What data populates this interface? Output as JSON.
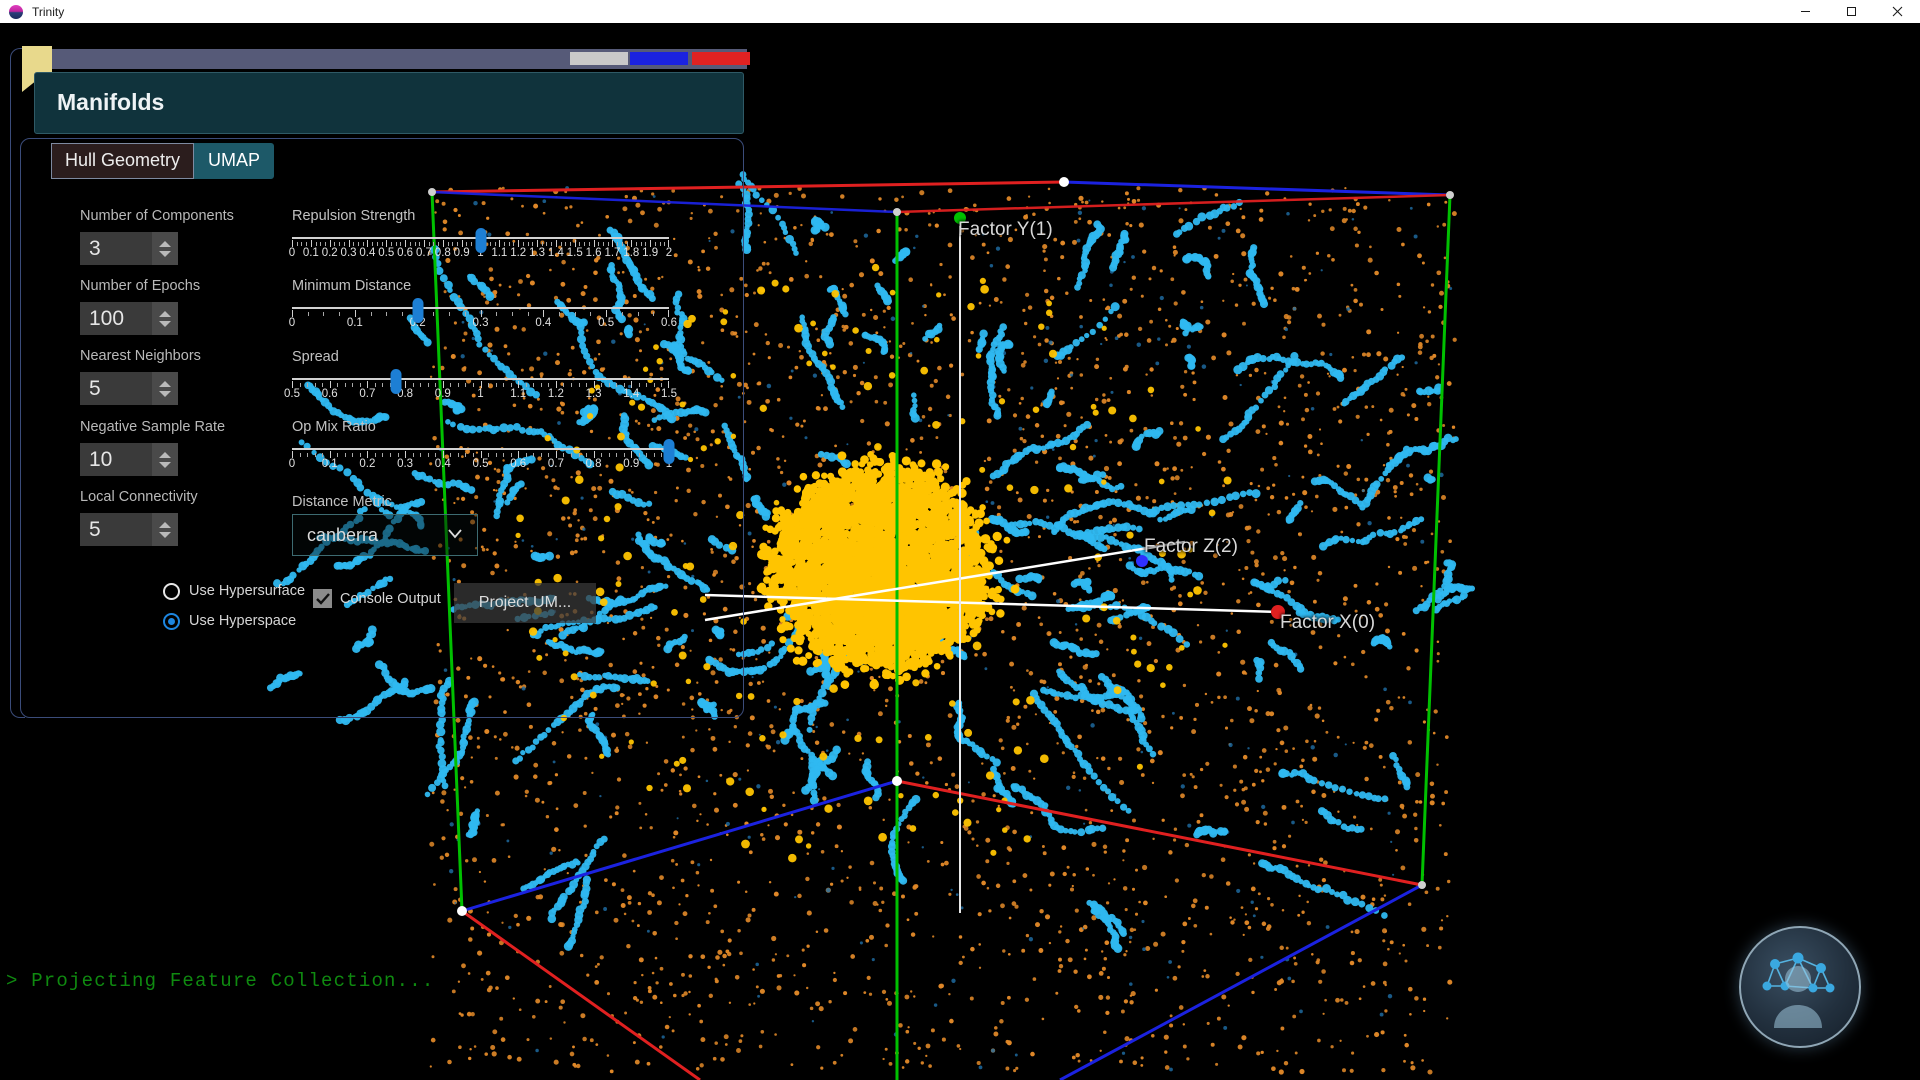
{
  "window": {
    "title": "Trinity",
    "app_icon": "trinity-orb-icon",
    "controls": [
      {
        "name": "minimize",
        "glyph": "minimize-icon"
      },
      {
        "name": "maximize",
        "glyph": "maximize-icon"
      },
      {
        "name": "close",
        "glyph": "close-icon"
      }
    ]
  },
  "panel": {
    "title": "Manifolds",
    "topbar_chips": [
      {
        "name": "chip-grey",
        "color": "#c9c9c9"
      },
      {
        "name": "chip-blue",
        "color": "#1b22e0"
      },
      {
        "name": "chip-red",
        "color": "#e02222"
      }
    ],
    "tabs": [
      {
        "label": "Hull Geometry",
        "active": false
      },
      {
        "label": "UMAP",
        "active": true
      }
    ],
    "numeric_fields": [
      {
        "label": "Number of Components",
        "value": "3"
      },
      {
        "label": "Number of Epochs",
        "value": "100"
      },
      {
        "label": "Nearest Neighbors",
        "value": "5"
      },
      {
        "label": "Negative Sample Rate",
        "value": "10"
      },
      {
        "label": "Local Connectivity",
        "value": "5"
      }
    ],
    "sliders": [
      {
        "label": "Repulsion Strength",
        "min": 0,
        "max": 2,
        "value": 1.0,
        "ticks": [
          "0",
          "0.1",
          "0.2",
          "0.3",
          "0.4",
          "0.5",
          "0.6",
          "0.7",
          "0.8",
          "0.9",
          "1",
          "1.1",
          "1.2",
          "1.3",
          "1.4",
          "1.5",
          "1.6",
          "1.7",
          "1.8",
          "1.9",
          "2"
        ],
        "minor_per_major": 4
      },
      {
        "label": "Minimum Distance",
        "min": 0,
        "max": 0.6,
        "value": 0.2,
        "ticks": [
          "0",
          "0.1",
          "0.2",
          "0.3",
          "0.4",
          "0.5",
          "0.6"
        ],
        "minor_per_major": 4
      },
      {
        "label": "Spread",
        "min": 0.5,
        "max": 1.5,
        "value": 0.775,
        "ticks": [
          "0.5",
          "0.6",
          "0.7",
          "0.8",
          "0.9",
          "1",
          "1.1",
          "1.2",
          "1.3",
          "1.4",
          "1.5"
        ],
        "minor_per_major": 5
      },
      {
        "label": "Op Mix Ratio",
        "min": 0,
        "max": 1,
        "value": 1.0,
        "ticks": [
          "0",
          "0.1",
          "0.2",
          "0.3",
          "0.4",
          "0.5",
          "0.6",
          "0.7",
          "0.8",
          "0.9",
          "1"
        ],
        "minor_per_major": 5
      }
    ],
    "distance_metric": {
      "label": "Distance Metric",
      "value": "canberra",
      "caret": "chevron-down-icon"
    },
    "radios": [
      {
        "label": "Use Hypersurface",
        "selected": false
      },
      {
        "label": "Use Hyperspace",
        "selected": true
      }
    ],
    "checkbox": {
      "label": "Console Output",
      "checked": true,
      "glyph": "checkmark-icon"
    },
    "project_button": {
      "label": "Project UM..."
    }
  },
  "viewport": {
    "axis_labels": [
      {
        "text": "Factor Y(1)",
        "axis": "y",
        "endpoint_color": "#00c000"
      },
      {
        "text": "Factor Z(2)",
        "axis": "z",
        "endpoint_color": "#3030ff"
      },
      {
        "text": "Factor X(0)",
        "axis": "x",
        "endpoint_color": "#e02020"
      }
    ],
    "axis_colors": {
      "x": "#e02020",
      "y": "#00c000",
      "z": "#1b22e0"
    },
    "point_colors": {
      "cluster": "#ffc400",
      "filament": "#2fb8f0",
      "scatter": "#e08828"
    }
  },
  "console": {
    "text": "> Projecting Feature Collection...",
    "color": "#0f8a10"
  },
  "orb": {
    "name": "network-graph-orb",
    "icon": "network-graph-icon"
  }
}
